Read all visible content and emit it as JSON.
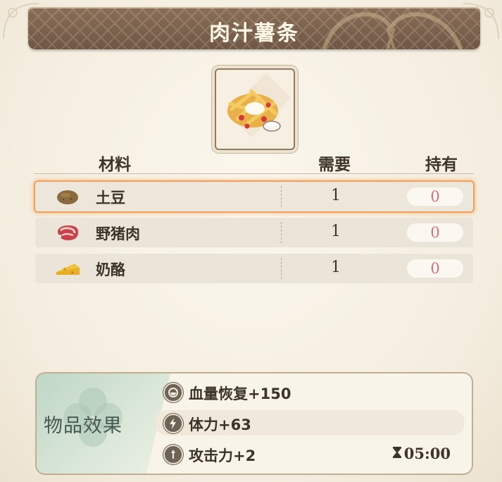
{
  "title": "肉汁薯条",
  "dish": {
    "icon": "meat-gravy-fries-dish-icon"
  },
  "table": {
    "headers": {
      "material": "材料",
      "need": "需要",
      "have": "持有"
    },
    "rows": [
      {
        "name": "土豆",
        "icon": "potato-icon",
        "need": "1",
        "have": "0",
        "selected": true
      },
      {
        "name": "野猪肉",
        "icon": "boar-meat-icon",
        "need": "1",
        "have": "0",
        "selected": false
      },
      {
        "name": "奶酪",
        "icon": "cheese-icon",
        "need": "1",
        "have": "0",
        "selected": false
      }
    ]
  },
  "effects": {
    "title": "物品效果",
    "items": [
      {
        "icon": "heart-restore-icon",
        "text": "血量恢复+150"
      },
      {
        "icon": "lightning-stamina-icon",
        "text": "体力+63"
      },
      {
        "icon": "attack-up-icon",
        "text": "攻击力+2"
      }
    ],
    "timer": {
      "icon": "hourglass-icon",
      "value": "05:00"
    }
  },
  "colors": {
    "banner": "#6f5744",
    "owned_zero": "#d4707a",
    "selected_glow": "#f0a05a",
    "effects_panel": "#bfd6c6"
  }
}
